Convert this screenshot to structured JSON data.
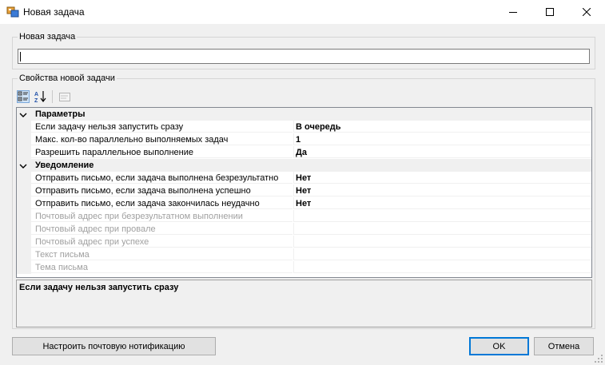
{
  "window": {
    "title": "Новая задача",
    "icon": "app-window-icon",
    "controls": [
      "minimize-icon",
      "maximize-icon",
      "close-icon"
    ]
  },
  "new_task": {
    "group_label": "Новая задача",
    "input_value": "",
    "input_placeholder": ""
  },
  "properties": {
    "group_label": "Свойства новой задачи",
    "toolbar": [
      "categorized-icon",
      "alphabetical-sort-icon",
      "property-pages-icon"
    ],
    "categories": [
      {
        "label": "Параметры",
        "expanded": true,
        "rows": [
          {
            "name": "Если задачу нельзя запустить сразу",
            "value": "В очередь"
          },
          {
            "name": "Макс. кол-во параллельно выполняемых задач",
            "value": "1"
          },
          {
            "name": "Разрешить параллельное выполнение",
            "value": "Да"
          }
        ]
      },
      {
        "label": "Уведомление",
        "expanded": true,
        "rows": [
          {
            "name": "Отправить письмо, если задача выполнена безрезультатно",
            "value": "Нет"
          },
          {
            "name": "Отправить письмо, если задача выполнена успешно",
            "value": "Нет"
          },
          {
            "name": "Отправить письмо, если задача закончилась неудачно",
            "value": "Нет"
          },
          {
            "name": "Почтовый адрес при безрезультатном выполнении",
            "value": "",
            "disabled": true
          },
          {
            "name": "Почтовый адрес при провале",
            "value": "",
            "disabled": true
          },
          {
            "name": "Почтовый адрес при успехе",
            "value": "",
            "disabled": true
          },
          {
            "name": "Текст письма",
            "value": "",
            "disabled": true
          },
          {
            "name": "Тема письма",
            "value": "",
            "disabled": true
          }
        ]
      }
    ],
    "description_title": "Если задачу нельзя запустить сразу"
  },
  "buttons": {
    "notify_label": "Настроить почтовую нотификацию",
    "ok_label": "OK",
    "cancel_label": "Отмена"
  },
  "colors": {
    "window_bg": "#f0f0f0",
    "grid_line": "#f0f0f0",
    "disabled_text": "#a0a0a0",
    "default_button_border": "#0078d7"
  }
}
